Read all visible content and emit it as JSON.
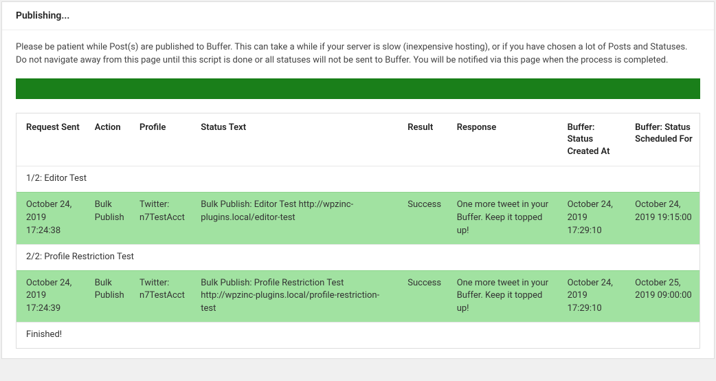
{
  "header": {
    "title": "Publishing..."
  },
  "notice": "Please be patient while Post(s) are published to Buffer. This can take a while if your server is slow (inexpensive hosting), or if you have chosen a lot of Posts and Statuses. Do not navigate away from this page until this script is done or all statuses will not be sent to Buffer. You will be notified via this page when the process is completed.",
  "columns": {
    "request_sent": "Request Sent",
    "action": "Action",
    "profile": "Profile",
    "status_text": "Status Text",
    "result": "Result",
    "response": "Response",
    "created_at": "Buffer: Status Created At",
    "scheduled_for": "Buffer: Status Scheduled For"
  },
  "sections": [
    {
      "label": "1/2: Editor Test",
      "row": {
        "request_sent": "October 24, 2019 17:24:38",
        "action": "Bulk Publish",
        "profile": "Twitter: n7TestAcct",
        "status_text": "Bulk Publish: Editor Test http://wpzinc-plugins.local/editor-test",
        "result": "Success",
        "response": "One more tweet in your Buffer. Keep it topped up!",
        "created_at": "October 24, 2019 17:29:10",
        "scheduled_for": "October 24, 2019 19:15:00"
      }
    },
    {
      "label": "2/2: Profile Restriction Test",
      "row": {
        "request_sent": "October 24, 2019 17:24:39",
        "action": "Bulk Publish",
        "profile": "Twitter: n7TestAcct",
        "status_text": "Bulk Publish: Profile Restriction Test http://wpzinc-plugins.local/profile-restriction-test",
        "result": "Success",
        "response": "One more tweet in your Buffer. Keep it topped up!",
        "created_at": "October 24, 2019 17:29:10",
        "scheduled_for": "October 25, 2019 09:00:00"
      }
    }
  ],
  "finished": "Finished!"
}
